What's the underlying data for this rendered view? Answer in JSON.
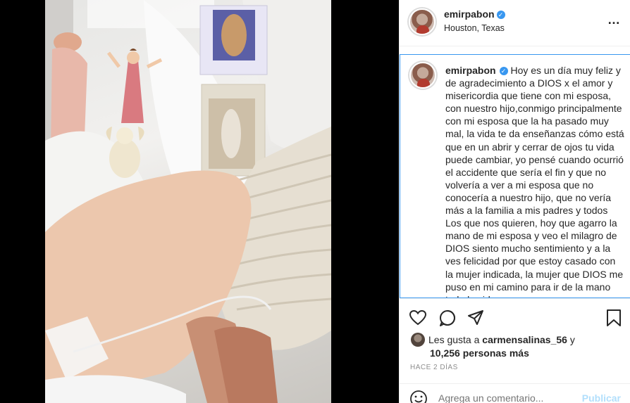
{
  "post": {
    "username": "emirpabon",
    "verified_mark": "✓",
    "location": "Houston, Texas",
    "more_icon": "…",
    "caption_text": "Hoy es un día muy feliz y de agradecimiento a DIOS x el amor y misericordia que tiene con mi esposa, con nuestro hijo,conmigo principalmente con mi esposa que la ha pasado muy mal, la vida te da enseñanzas cómo está que en un abrir y cerrar de ojos tu vida puede cambiar, yo pensé cuando ocurrió el accidente que sería el fin y que no volvería a ver a mi esposa que no conocería a nuestro hijo, que no vería más a la familia a mis padres y todos Los que nos quieren, hoy que agarro la mano de mi esposa y veo el milagro de DIOS siento mucho sentimiento y a la ves felicidad por que estoy casado con la mujer indicada, la mujer que DIOS me puso en mi camino para ir de la mano toda la vida, es una"
  },
  "likes": {
    "prefix": "Les gusta a",
    "liker": "carmensalinas_56",
    "conjunction": "y",
    "others": "10,256 personas más"
  },
  "timestamp": "HACE 2 DÍAS",
  "comment": {
    "placeholder": "Agrega un comentario...",
    "publish_label": "Publicar"
  },
  "icons": [
    "heart-icon",
    "comment-icon",
    "share-icon",
    "bookmark-icon",
    "smile-icon"
  ],
  "colors": {
    "verified": "#3897f0",
    "publish": "#b2dffc",
    "muted": "#8e8e8e",
    "text": "#262626"
  }
}
